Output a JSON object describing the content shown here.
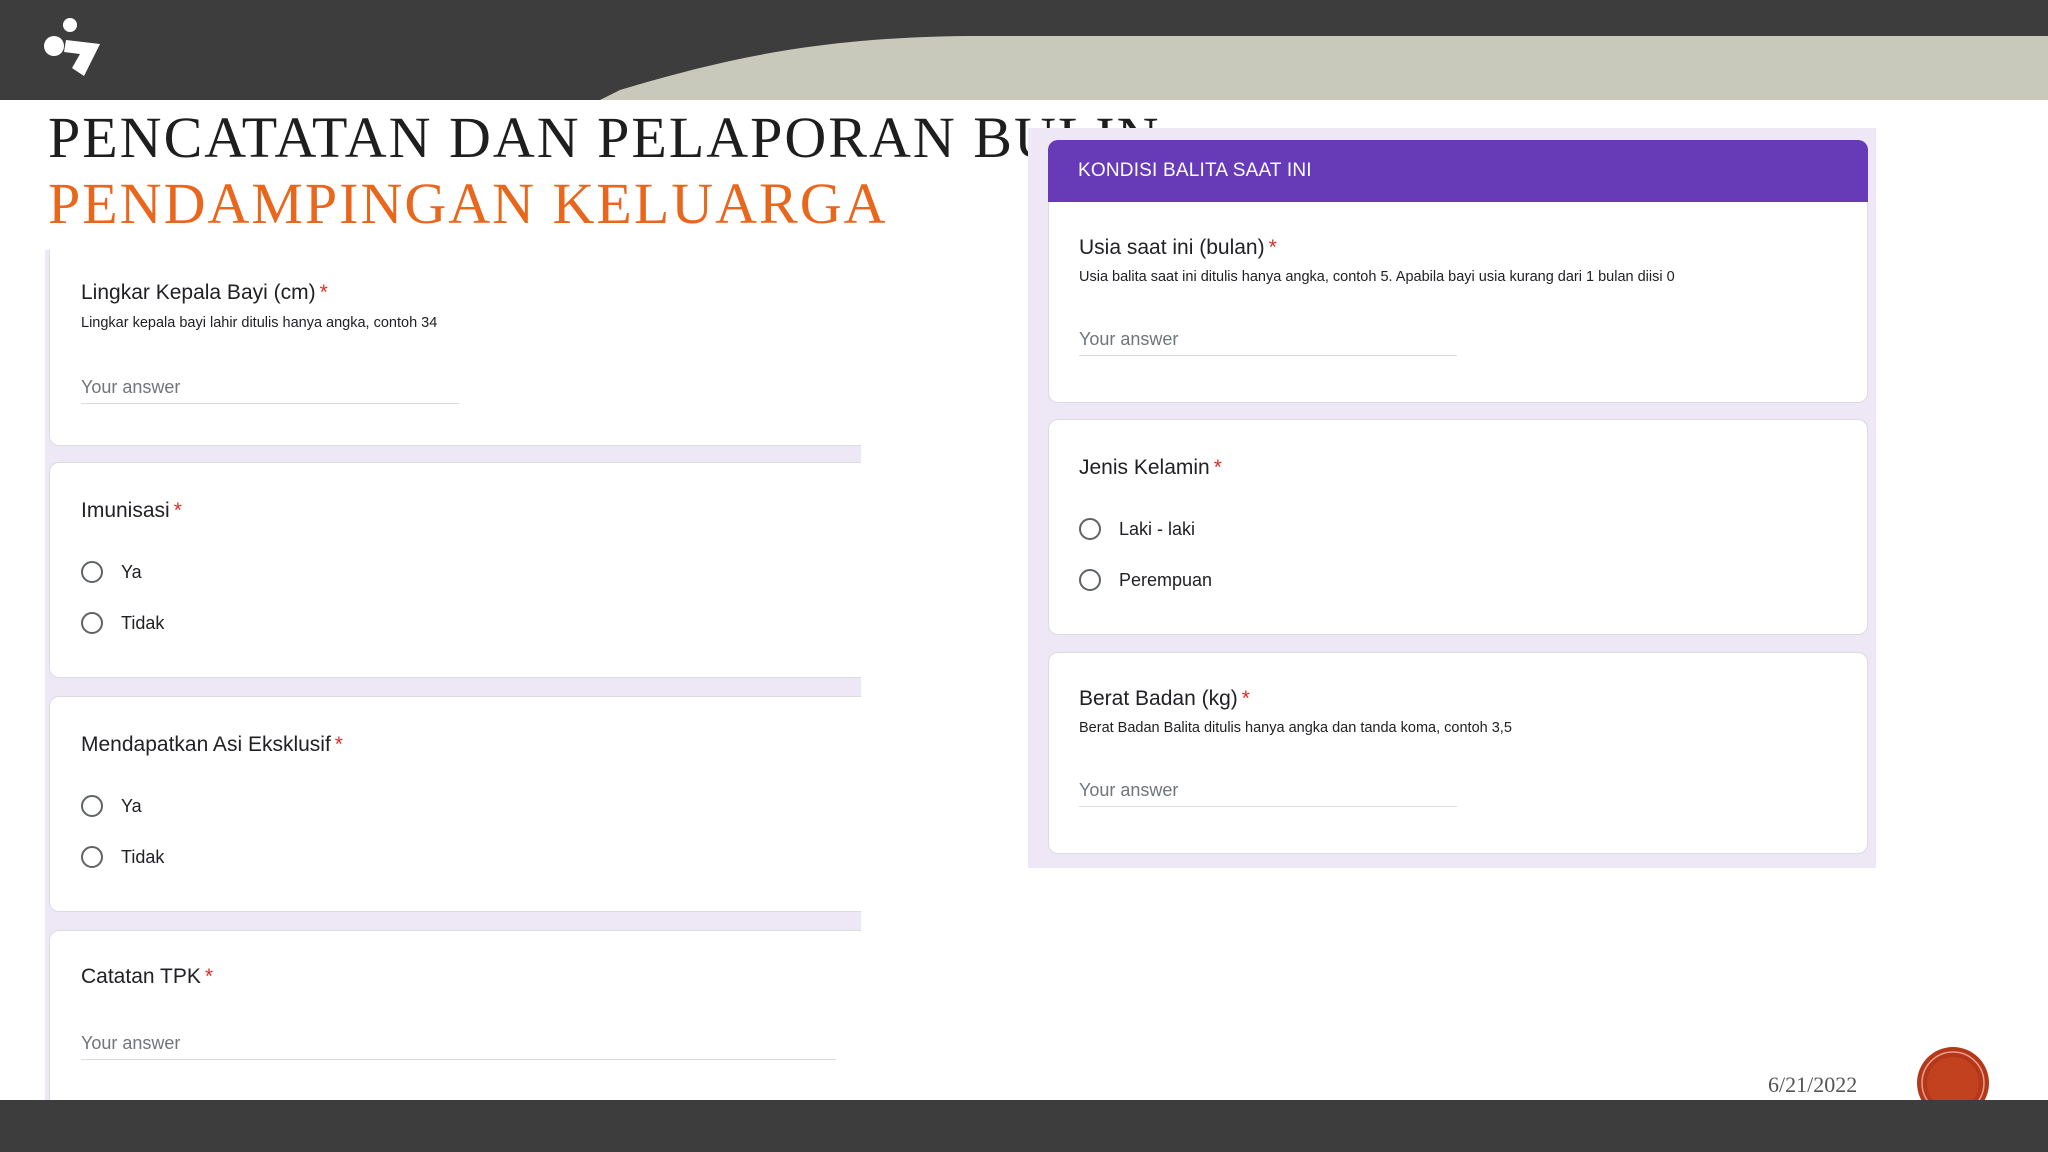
{
  "slide": {
    "title_line1": "PENCATATAN DAN PELAPORAN BULIN",
    "title_line2": "PENDAMPINGAN KELUARGA",
    "date": "6/21/2022",
    "logo_icon": "app-logo-icon",
    "accent_color": "#e8671c",
    "form_accent": "#673ab7"
  },
  "left_form": {
    "lingkar": {
      "title": "Lingkar Kepala Bayi (cm)",
      "required": "*",
      "help": "Lingkar kepala bayi lahir ditulis hanya angka, contoh 34",
      "placeholder": "Your answer"
    },
    "imunisasi": {
      "title": "Imunisasi",
      "required": "*",
      "options": [
        "Ya",
        "Tidak"
      ]
    },
    "asi": {
      "title": "Mendapatkan Asi Eksklusif",
      "required": "*",
      "options": [
        "Ya",
        "Tidak"
      ]
    },
    "catatan": {
      "title": "Catatan TPK",
      "required": "*",
      "placeholder": "Your answer"
    }
  },
  "right_form": {
    "section_header": "KONDISI BALITA SAAT INI",
    "usia": {
      "title": "Usia saat ini (bulan)",
      "required": "*",
      "help": "Usia balita saat ini ditulis hanya angka, contoh 5. Apabila bayi usia kurang dari 1 bulan diisi 0",
      "placeholder": "Your answer"
    },
    "jenis_kelamin": {
      "title": "Jenis Kelamin",
      "required": "*",
      "options": [
        "Laki - laki",
        "Perempuan"
      ]
    },
    "berat": {
      "title": "Berat Badan (kg)",
      "required": "*",
      "help": "Berat Badan Balita ditulis hanya angka dan tanda koma, contoh 3,5",
      "placeholder": "Your answer"
    }
  }
}
